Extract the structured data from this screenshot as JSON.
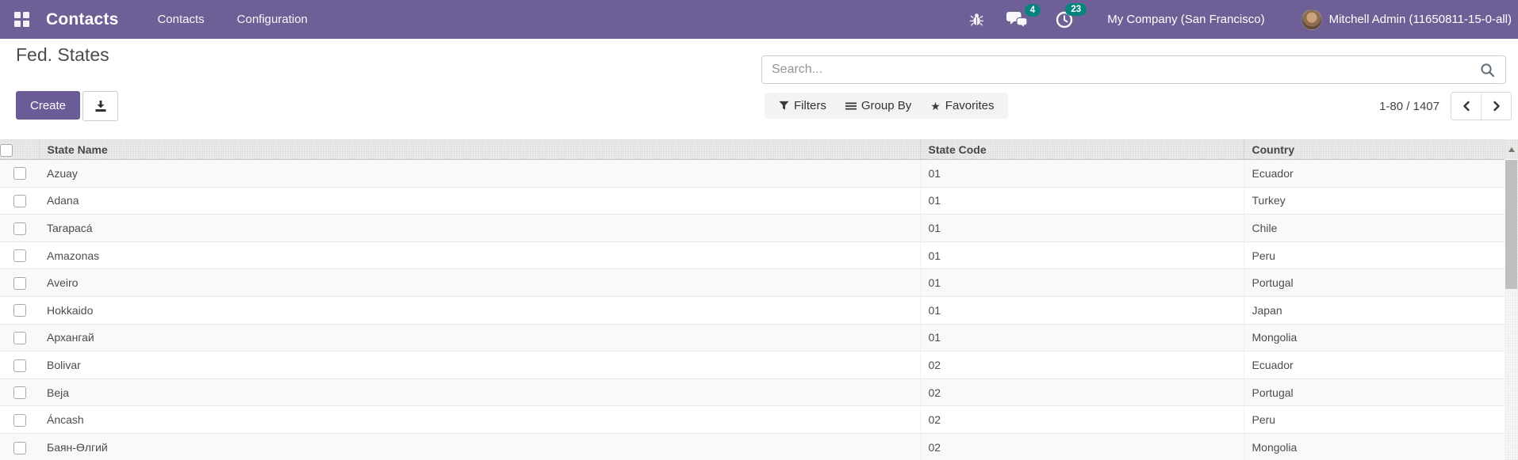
{
  "colors": {
    "navbar_bg": "#6e6096",
    "badge_bg": "#06837f",
    "brand_button": "#6b5b97"
  },
  "icons": {
    "apps": "grid-2x2",
    "debug": "bug",
    "messages": "chat-bubbles",
    "activities": "clock",
    "search": "magnifier",
    "filters": "funnel",
    "group_by": "horizontal-bars",
    "favorites": "star",
    "export": "download-tray",
    "pager_prev": "chevron-left",
    "pager_next": "chevron-right",
    "scroll_up": "triangle-up"
  },
  "navbar": {
    "brand": "Contacts",
    "menu_items": [
      {
        "label": "Contacts"
      },
      {
        "label": "Configuration"
      }
    ],
    "message_badge": "4",
    "activity_badge": "23",
    "company": "My Company (San Francisco)",
    "user": "Mitchell Admin (11650811-15-0-all)"
  },
  "control_panel": {
    "title": "Fed. States",
    "create_label": "Create",
    "search_placeholder": "Search...",
    "filters_label": "Filters",
    "group_by_label": "Group By",
    "favorites_label": "Favorites",
    "pager_text": "1-80 / 1407",
    "favorites_star": "★"
  },
  "table": {
    "columns": [
      "State Name",
      "State Code",
      "Country"
    ],
    "rows": [
      {
        "name": "Azuay",
        "code": "01",
        "country": "Ecuador"
      },
      {
        "name": "Adana",
        "code": "01",
        "country": "Turkey"
      },
      {
        "name": "Tarapacá",
        "code": "01",
        "country": "Chile"
      },
      {
        "name": "Amazonas",
        "code": "01",
        "country": "Peru"
      },
      {
        "name": "Aveiro",
        "code": "01",
        "country": "Portugal"
      },
      {
        "name": "Hokkaido",
        "code": "01",
        "country": "Japan"
      },
      {
        "name": "Архангай",
        "code": "01",
        "country": "Mongolia"
      },
      {
        "name": "Bolivar",
        "code": "02",
        "country": "Ecuador"
      },
      {
        "name": "Beja",
        "code": "02",
        "country": "Portugal"
      },
      {
        "name": "Áncash",
        "code": "02",
        "country": "Peru"
      },
      {
        "name": "Баян-Өлгий",
        "code": "02",
        "country": "Mongolia"
      }
    ]
  }
}
